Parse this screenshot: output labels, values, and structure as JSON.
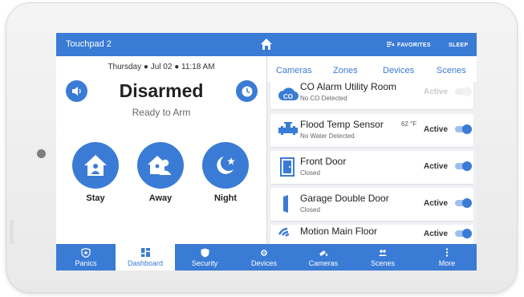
{
  "topbar": {
    "title": "Touchpad 2",
    "favorites_label": "FAVORITES",
    "sleep_label": "SLEEP"
  },
  "security": {
    "date": "Thursday",
    "day": "Jul 02",
    "time": "11:18 AM",
    "status": "Disarmed",
    "substatus": "Ready to Arm",
    "arm_buttons": [
      {
        "label": "Stay",
        "icon": "house-person-icon"
      },
      {
        "label": "Away",
        "icon": "house-people-icon"
      },
      {
        "label": "Night",
        "icon": "moon-star-icon"
      }
    ]
  },
  "tabs": [
    "Cameras",
    "Zones",
    "Devices",
    "Scenes"
  ],
  "active_tab": "Zones",
  "zones": [
    {
      "name": "CO Alarm Utility Room",
      "status": "No CO Detected",
      "state": "Active",
      "icon": "co-icon",
      "enabled": false
    },
    {
      "name": "Flood Temp Sensor",
      "status": "No Water Detected",
      "temp": "62 °F",
      "state": "Active",
      "icon": "pipe-icon",
      "enabled": true
    },
    {
      "name": "Front Door",
      "status": "Closed",
      "state": "Active",
      "icon": "door-icon",
      "enabled": true
    },
    {
      "name": "Garage Double Door",
      "status": "Closed",
      "state": "Active",
      "icon": "garage-door-icon",
      "enabled": true
    },
    {
      "name": "Motion Main Floor",
      "status": "",
      "state": "Active",
      "icon": "motion-icon",
      "enabled": true
    }
  ],
  "nav": [
    {
      "label": "Panics",
      "icon": "shield-star-icon"
    },
    {
      "label": "Dashboard",
      "icon": "grid-icon",
      "active": true
    },
    {
      "label": "Security",
      "icon": "shield-icon"
    },
    {
      "label": "Devices",
      "icon": "devices-icon"
    },
    {
      "label": "Cameras",
      "icon": "camera-icon"
    },
    {
      "label": "Scenes",
      "icon": "people-icon"
    },
    {
      "label": "More",
      "icon": "more-icon"
    }
  ],
  "colors": {
    "accent": "#3a7bd5",
    "panel_bg": "#eef0f3"
  }
}
